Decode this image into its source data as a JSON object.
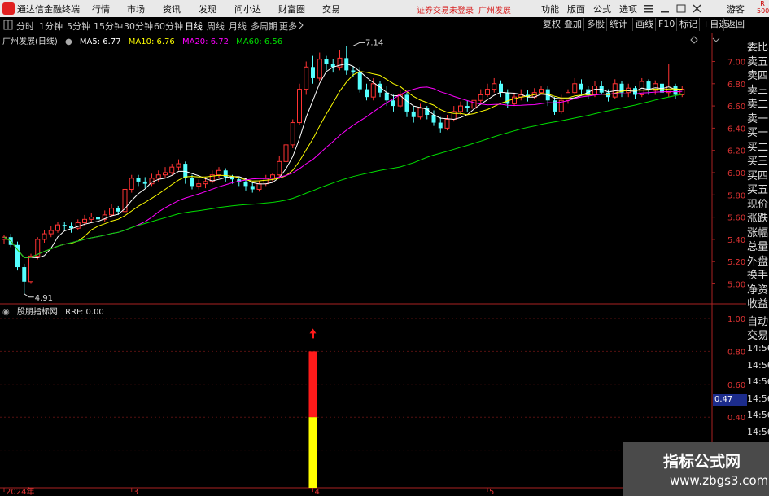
{
  "app": {
    "title": "通达信金融终端",
    "menu": [
      "行情",
      "市场",
      "资讯",
      "发现",
      "问小达",
      "财富圈",
      "交易"
    ],
    "notice": "证券交易未登录",
    "stock_name": "广州发展",
    "right_menu": [
      "功能",
      "版面",
      "公式",
      "选项"
    ],
    "guest": "游客",
    "badge_top": "R",
    "badge_bottom": "500"
  },
  "toolbar": {
    "tabs": [
      "分时",
      "1分钟",
      "5分钟",
      "15分钟",
      "30分钟",
      "60分钟",
      "日线",
      "周线",
      "月线",
      "多周期",
      "更多"
    ],
    "active_tab": "日线",
    "right_buttons": [
      "复权",
      "叠加",
      "多股",
      "统计",
      "画线",
      "F10",
      "标记",
      "+自选",
      "返回"
    ]
  },
  "main_legend": {
    "title": "广州发展(日线)",
    "ma5": "MA5: 6.77",
    "ma10": "MA10: 6.76",
    "ma20": "MA20: 6.72",
    "ma60": "MA60: 6.56"
  },
  "indicator_legend": {
    "title": "股朋指标网",
    "value": "RRF: 0.00"
  },
  "price_marks": {
    "high": "7.14",
    "low": "4.91"
  },
  "side_panel": {
    "labels": [
      "委比",
      "卖五",
      "卖四",
      "卖三",
      "卖二",
      "卖一",
      "买一",
      "买二",
      "买三",
      "买四",
      "买五",
      "现价",
      "涨跌",
      "涨幅",
      "总量",
      "外盘",
      "换手",
      "净资",
      "收益"
    ],
    "lower_labels": [
      "自动",
      "交易"
    ],
    "times": [
      "14:56",
      "14:56",
      "14:56",
      "14:56",
      "14:56",
      "14:56",
      "14:56",
      "14:56"
    ]
  },
  "indicator_value_box": "0.47",
  "watermark": {
    "line1": "指标公式网",
    "line2": "www.zbgs3.com"
  },
  "colors": {
    "up": "#ff3333",
    "down": "#54ffff",
    "ma5": "#ffffff",
    "ma10": "#ffff00",
    "ma20": "#ff00ff",
    "ma60": "#00dd00"
  },
  "chart_data": [
    {
      "type": "candlestick",
      "title": "广州发展(日线)",
      "ylim": [
        4.85,
        7.15
      ],
      "yticks": [
        5.0,
        5.2,
        5.4,
        5.6,
        5.8,
        6.0,
        6.2,
        6.4,
        6.6,
        6.8,
        7.0
      ],
      "x_labels": [
        {
          "index": 0,
          "label": "2024年"
        },
        {
          "index": 19,
          "label": "3"
        },
        {
          "index": 46,
          "label": "4"
        },
        {
          "index": 72,
          "label": "5"
        }
      ],
      "high_label": {
        "index": 52,
        "value": 7.14
      },
      "low_label": {
        "index": 3,
        "value": 4.91
      },
      "candles": [
        [
          5.4,
          5.42,
          5.36,
          5.44
        ],
        [
          5.42,
          5.35,
          5.33,
          5.45
        ],
        [
          5.35,
          5.15,
          5.12,
          5.38
        ],
        [
          5.15,
          5.02,
          4.91,
          5.18
        ],
        [
          5.02,
          5.25,
          5.0,
          5.27
        ],
        [
          5.25,
          5.4,
          5.22,
          5.42
        ],
        [
          5.4,
          5.45,
          5.37,
          5.48
        ],
        [
          5.45,
          5.48,
          5.42,
          5.52
        ],
        [
          5.48,
          5.53,
          5.46,
          5.56
        ],
        [
          5.53,
          5.52,
          5.48,
          5.56
        ],
        [
          5.52,
          5.5,
          5.46,
          5.55
        ],
        [
          5.5,
          5.55,
          5.48,
          5.58
        ],
        [
          5.55,
          5.58,
          5.52,
          5.62
        ],
        [
          5.58,
          5.6,
          5.55,
          5.64
        ],
        [
          5.6,
          5.58,
          5.54,
          5.63
        ],
        [
          5.58,
          5.62,
          5.56,
          5.66
        ],
        [
          5.62,
          5.68,
          5.6,
          5.72
        ],
        [
          5.68,
          5.65,
          5.62,
          5.7
        ],
        [
          5.65,
          5.85,
          5.63,
          5.88
        ],
        [
          5.85,
          5.95,
          5.82,
          5.98
        ],
        [
          5.95,
          5.92,
          5.88,
          5.98
        ],
        [
          5.92,
          5.9,
          5.86,
          5.96
        ],
        [
          5.9,
          5.95,
          5.88,
          5.99
        ],
        [
          5.95,
          5.98,
          5.92,
          6.02
        ],
        [
          5.98,
          6.0,
          5.95,
          6.05
        ],
        [
          6.0,
          6.05,
          5.98,
          6.08
        ],
        [
          6.05,
          6.08,
          6.02,
          6.12
        ],
        [
          6.08,
          5.95,
          5.9,
          6.1
        ],
        [
          5.95,
          5.88,
          5.85,
          5.98
        ],
        [
          5.88,
          5.9,
          5.85,
          5.94
        ],
        [
          5.9,
          5.92,
          5.86,
          5.96
        ],
        [
          5.92,
          5.98,
          5.9,
          6.02
        ],
        [
          5.98,
          6.02,
          5.95,
          6.05
        ],
        [
          6.02,
          5.96,
          5.92,
          6.04
        ],
        [
          5.96,
          5.94,
          5.9,
          5.98
        ],
        [
          5.94,
          5.92,
          5.88,
          5.96
        ],
        [
          5.92,
          5.88,
          5.84,
          5.95
        ],
        [
          5.88,
          5.85,
          5.82,
          5.92
        ],
        [
          5.85,
          5.9,
          5.83,
          5.93
        ],
        [
          5.9,
          5.95,
          5.88,
          5.98
        ],
        [
          5.95,
          5.98,
          5.92,
          6.0
        ],
        [
          5.98,
          6.1,
          5.96,
          6.15
        ],
        [
          6.1,
          6.25,
          6.08,
          6.28
        ],
        [
          6.25,
          6.45,
          6.22,
          6.48
        ],
        [
          6.45,
          6.75,
          6.43,
          6.8
        ],
        [
          6.75,
          6.95,
          6.7,
          7.0
        ],
        [
          6.95,
          6.85,
          6.8,
          7.05
        ],
        [
          6.85,
          7.02,
          6.82,
          7.08
        ],
        [
          7.02,
          6.98,
          6.92,
          7.05
        ],
        [
          6.98,
          6.95,
          6.9,
          7.02
        ],
        [
          6.95,
          7.03,
          6.92,
          7.1
        ],
        [
          7.03,
          6.92,
          6.88,
          7.14
        ],
        [
          6.92,
          6.9,
          6.86,
          6.96
        ],
        [
          6.9,
          6.75,
          6.72,
          6.95
        ],
        [
          6.75,
          6.68,
          6.65,
          6.8
        ],
        [
          6.68,
          6.8,
          6.65,
          6.85
        ],
        [
          6.8,
          6.72,
          6.68,
          6.82
        ],
        [
          6.72,
          6.65,
          6.6,
          6.78
        ],
        [
          6.65,
          6.6,
          6.55,
          6.7
        ],
        [
          6.6,
          6.7,
          6.58,
          6.74
        ],
        [
          6.7,
          6.55,
          6.5,
          6.72
        ],
        [
          6.55,
          6.5,
          6.45,
          6.6
        ],
        [
          6.5,
          6.58,
          6.48,
          6.62
        ],
        [
          6.58,
          6.52,
          6.48,
          6.6
        ],
        [
          6.52,
          6.45,
          6.42,
          6.56
        ],
        [
          6.45,
          6.4,
          6.36,
          6.5
        ],
        [
          6.4,
          6.48,
          6.38,
          6.52
        ],
        [
          6.48,
          6.55,
          6.46,
          6.6
        ],
        [
          6.55,
          6.6,
          6.52,
          6.64
        ],
        [
          6.6,
          6.58,
          6.55,
          6.65
        ],
        [
          6.58,
          6.65,
          6.56,
          6.7
        ],
        [
          6.65,
          6.7,
          6.62,
          6.75
        ],
        [
          6.7,
          6.75,
          6.68,
          6.8
        ],
        [
          6.75,
          6.8,
          6.72,
          6.85
        ],
        [
          6.8,
          6.72,
          6.68,
          6.83
        ],
        [
          6.72,
          6.62,
          6.58,
          6.75
        ],
        [
          6.62,
          6.68,
          6.6,
          6.72
        ],
        [
          6.68,
          6.7,
          6.65,
          6.75
        ],
        [
          6.7,
          6.68,
          6.64,
          6.74
        ],
        [
          6.68,
          6.72,
          6.66,
          6.76
        ],
        [
          6.72,
          6.75,
          6.7,
          6.78
        ],
        [
          6.75,
          6.65,
          6.6,
          6.78
        ],
        [
          6.65,
          6.55,
          6.52,
          6.68
        ],
        [
          6.55,
          6.65,
          6.53,
          6.7
        ],
        [
          6.65,
          6.72,
          6.62,
          6.75
        ],
        [
          6.72,
          6.8,
          6.7,
          6.85
        ],
        [
          6.8,
          6.75,
          6.7,
          6.84
        ],
        [
          6.75,
          6.7,
          6.66,
          6.78
        ],
        [
          6.7,
          6.78,
          6.68,
          6.82
        ],
        [
          6.78,
          6.72,
          6.7,
          6.82
        ],
        [
          6.72,
          6.68,
          6.64,
          6.75
        ],
        [
          6.68,
          6.8,
          6.66,
          6.84
        ],
        [
          6.8,
          6.72,
          6.68,
          6.82
        ],
        [
          6.72,
          6.76,
          6.68,
          6.8
        ],
        [
          6.76,
          6.7,
          6.66,
          6.78
        ],
        [
          6.7,
          6.82,
          6.68,
          6.85
        ],
        [
          6.82,
          6.74,
          6.7,
          6.84
        ],
        [
          6.74,
          6.8,
          6.7,
          6.83
        ],
        [
          6.8,
          6.72,
          6.68,
          6.82
        ],
        [
          6.72,
          6.78,
          6.68,
          6.98
        ],
        [
          6.78,
          6.7,
          6.66,
          6.8
        ],
        [
          6.7,
          6.75,
          6.68,
          6.78
        ]
      ]
    },
    {
      "type": "bar",
      "title": "股朋指标网",
      "ylim": [
        0,
        1.0
      ],
      "yticks": [
        0.2,
        0.4,
        0.6,
        0.8,
        1.0
      ],
      "signals": [
        {
          "index": 46,
          "red_top": 0.8,
          "yellow_top": 0.4,
          "arrow": true
        }
      ]
    }
  ]
}
